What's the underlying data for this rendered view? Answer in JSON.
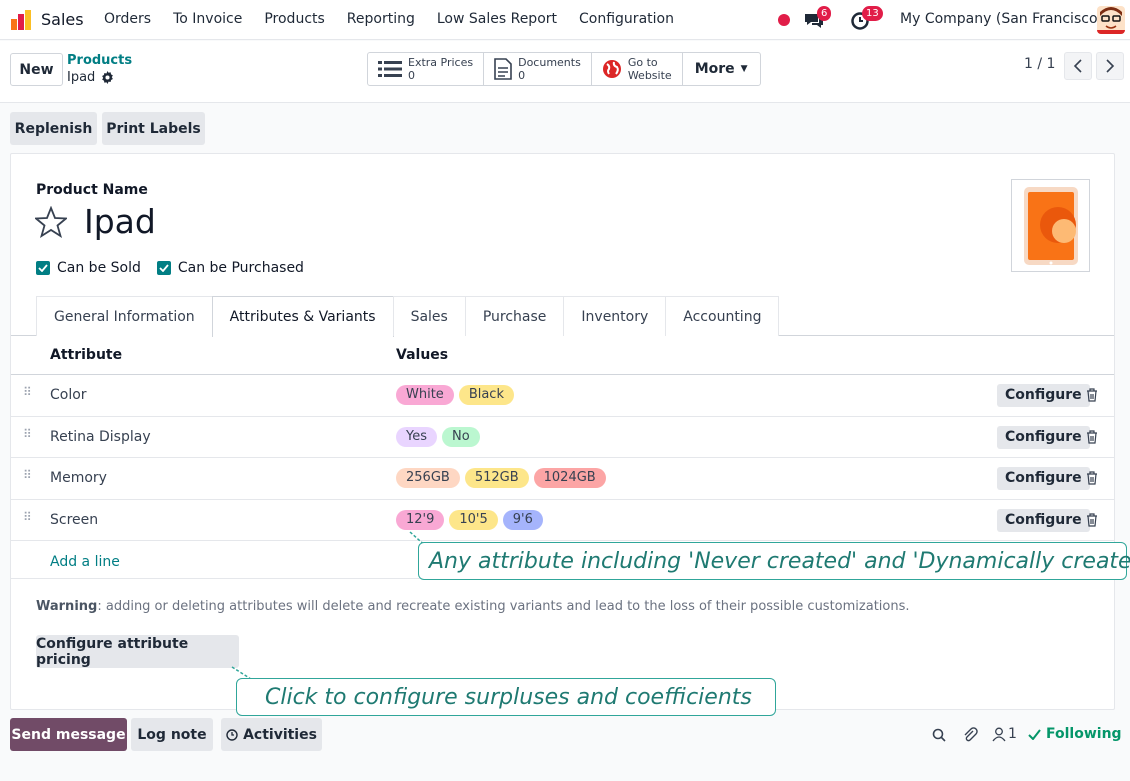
{
  "navbar": {
    "app_name": "Sales",
    "menu": [
      "Orders",
      "To Invoice",
      "Products",
      "Reporting",
      "Low Sales Report",
      "Configuration"
    ],
    "chat_badge": "6",
    "activity_badge": "13",
    "company": "My Company (San Francisco)"
  },
  "control": {
    "new_label": "New",
    "breadcrumb_parent": "Products",
    "breadcrumb_current": "Ipad",
    "smart_buttons": [
      {
        "label": "Extra Prices",
        "value": "0",
        "icon": "list-icon"
      },
      {
        "label": "Documents",
        "value": "0",
        "icon": "document-icon"
      },
      {
        "label": "Go to",
        "value": "Website",
        "icon": "globe-icon"
      }
    ],
    "more_label": "More",
    "pager": "1 / 1"
  },
  "actions": {
    "replenish": "Replenish",
    "print_labels": "Print Labels"
  },
  "form": {
    "field_label": "Product Name",
    "product_name": "Ipad",
    "can_be_sold": "Can be Sold",
    "can_be_purchased": "Can be Purchased",
    "tabs": [
      "General Information",
      "Attributes & Variants",
      "Sales",
      "Purchase",
      "Inventory",
      "Accounting"
    ],
    "active_tab": "Attributes & Variants"
  },
  "attributes": {
    "headers": {
      "attribute": "Attribute",
      "values": "Values"
    },
    "rows": [
      {
        "name": "Color",
        "values": [
          {
            "v": "White",
            "color": "#f9a8d4"
          },
          {
            "v": "Black",
            "color": "#fde68a"
          }
        ]
      },
      {
        "name": "Retina Display",
        "values": [
          {
            "v": "Yes",
            "color": "#e9d5ff"
          },
          {
            "v": "No",
            "color": "#bbf7d0"
          }
        ]
      },
      {
        "name": "Memory",
        "values": [
          {
            "v": "256GB",
            "color": "#fed7c3"
          },
          {
            "v": "512GB",
            "color": "#fde68a"
          },
          {
            "v": "1024GB",
            "color": "#fca5a5"
          }
        ]
      },
      {
        "name": "Screen",
        "values": [
          {
            "v": "12'9",
            "color": "#f9a8d4"
          },
          {
            "v": "10'5",
            "color": "#fde68a"
          },
          {
            "v": "9'6",
            "color": "#a5b4fc"
          }
        ]
      }
    ],
    "configure_label": "Configure",
    "add_line": "Add a line"
  },
  "warning": {
    "label": "Warning",
    "text": ": adding or deleting attributes will delete and recreate existing variants and lead to the loss of their possible customizations."
  },
  "configure_pricing": "Configure attribute pricing",
  "callouts": {
    "attributes": "Any attribute including 'Never created' and 'Dynamically created'",
    "pricing": "Click to configure surpluses and coefficients"
  },
  "chatter": {
    "send_message": "Send message",
    "log_note": "Log note",
    "activities": "Activities",
    "followers": "1",
    "following": "Following"
  },
  "colors": {
    "accent": "#017e84",
    "primary_button": "#714b67"
  }
}
